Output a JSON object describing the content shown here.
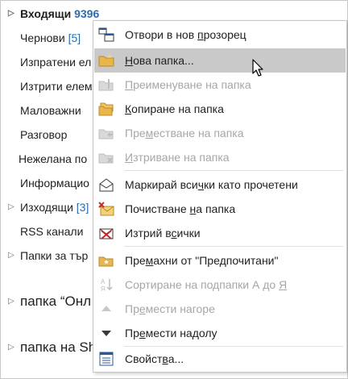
{
  "folders": [
    {
      "label": "Входящи",
      "count": "9396"
    },
    {
      "label": "Чернови",
      "count": "[5]"
    },
    {
      "label": "Изпратени ел",
      "count": ""
    },
    {
      "label": "Изтрити елем",
      "count": ""
    },
    {
      "label": "Маловажни",
      "count": ""
    },
    {
      "label": "Разговор",
      "count": ""
    },
    {
      "label": "Нежелана по",
      "count": ""
    },
    {
      "label": "Информацио",
      "count": ""
    },
    {
      "label": "Изходящи",
      "count": "[3]"
    },
    {
      "label": "RSS канали",
      "count": ""
    },
    {
      "label": "Папки за тър",
      "count": ""
    },
    {
      "label": "папка “Онл",
      "count": ""
    },
    {
      "label": "папка на Sh",
      "count": ""
    }
  ],
  "menu": [
    {
      "pre": "Отвори в нов ",
      "key": "п",
      "post": "розорец",
      "icon": "new-window-icon"
    },
    {
      "pre": "",
      "key": "Н",
      "post": "ова папка...",
      "icon": "new-folder-icon"
    },
    {
      "pre": "",
      "key": "П",
      "post": "реименуване на папка",
      "icon": "rename-folder-icon"
    },
    {
      "pre": "",
      "key": "К",
      "post": "опиране на папка",
      "icon": "copy-folder-icon"
    },
    {
      "pre": "Пре",
      "key": "м",
      "post": "естване на папка",
      "icon": "move-folder-icon"
    },
    {
      "pre": "",
      "key": "И",
      "post": "зтриване на папка",
      "icon": "delete-folder-icon"
    },
    {
      "pre": "Маркирай вси",
      "key": "ч",
      "post": "ки като прочетени",
      "icon": "mark-read-icon"
    },
    {
      "pre": "Почистване ",
      "key": "н",
      "post": "а папка",
      "icon": "clean-up-icon"
    },
    {
      "pre": "Изтрий в",
      "key": "с",
      "post": "ички",
      "icon": "delete-all-icon"
    },
    {
      "pre": "Пре",
      "key": "м",
      "post": "ахни от \"Предпочитани\"",
      "icon": "remove-favorite-icon"
    },
    {
      "pre": "Сортиране на подпапки А до ",
      "key": "Я",
      "post": "",
      "icon": "sort-az-icon"
    },
    {
      "pre": "Пр",
      "key": "е",
      "post": "мести нагоре",
      "icon": "move-up-icon"
    },
    {
      "pre": "Пр",
      "key": "е",
      "post": "мести надолу",
      "icon": "move-down-icon"
    },
    {
      "pre": "Свойст",
      "key": "в",
      "post": "а...",
      "icon": "properties-icon"
    }
  ]
}
